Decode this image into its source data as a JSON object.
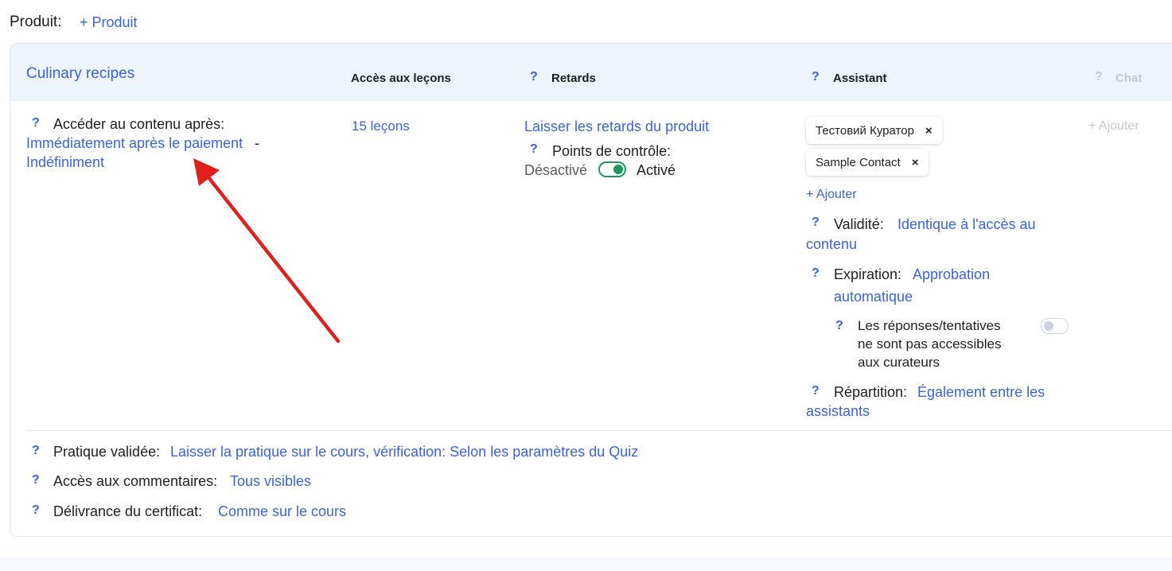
{
  "header": {
    "produit_label": "Produit:",
    "add_produit": "+ Produit"
  },
  "card": {
    "course_title": "Culinary recipes",
    "columns": {
      "lessons": "Accès aux leçons",
      "delays": "Retards",
      "assistant": "Assistant",
      "chat": "Chat"
    },
    "help_icon": "?",
    "access": {
      "label": "Accéder au contenu après:",
      "value_start": "Immédiatement après le paiement",
      "separator": "-",
      "value_end": "Indéfiniment"
    },
    "lessons": {
      "count": "15 leçons"
    },
    "delays": {
      "link": "Laisser les retards du produit",
      "checkpoints_label": "Points de contrôle:",
      "off_label": "Désactivé",
      "on_label": "Activé",
      "checkpoints_enabled": true
    },
    "assistant": {
      "chips": [
        {
          "name": "Тестовий Куратор",
          "remove": "×"
        },
        {
          "name": "Sample Contact",
          "remove": "×"
        }
      ],
      "add": "+ Ajouter",
      "validity_label": "Validité:",
      "validity_value_1": "Identique à l'accès au",
      "validity_value_2": "contenu",
      "expiration_label": "Expiration:",
      "expiration_value_1": "Approbation",
      "expiration_value_2": "automatique",
      "responses_line_1": "Les réponses/tentatives",
      "responses_line_2": "ne sont pas accessibles",
      "responses_line_3": "aux curateurs",
      "responses_enabled": false,
      "distribution_label": "Répartition:",
      "distribution_value_1": "Également entre les",
      "distribution_value_2": "assistants"
    },
    "chat": {
      "add": "+ Ajouter"
    },
    "footer_settings": {
      "practice_label": "Pratique validée:",
      "practice_value": "Laisser la pratique sur le cours, vérification: Selon les paramètres du Quiz",
      "comments_label": "Accès aux commentaires:",
      "comments_value": "Tous visibles",
      "certificate_label": "Délivrance du certificat:",
      "certificate_value": "Comme sur le cours"
    }
  },
  "colors": {
    "link": "#3b63d6",
    "header_bg": "#eef4fc",
    "toggle_on": "#1c9a5c",
    "annotation_arrow": "#e0201c"
  }
}
